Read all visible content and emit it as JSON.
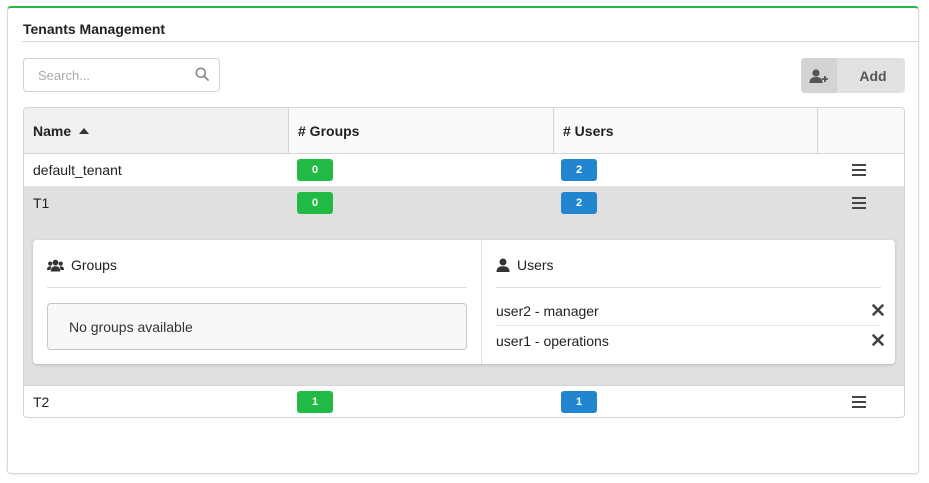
{
  "widget": {
    "title": "Tenants Management"
  },
  "search": {
    "placeholder": "Search..."
  },
  "add_button": {
    "label": "Add",
    "icon": "user-plus-icon"
  },
  "table": {
    "columns": [
      {
        "label": "Name",
        "sorted": "ascending"
      },
      {
        "label": "# Groups"
      },
      {
        "label": "# Users"
      },
      {
        "label": ""
      }
    ],
    "rows": [
      {
        "name": "default_tenant",
        "groups": "0",
        "users": "2",
        "selected": false
      },
      {
        "name": "T1",
        "groups": "0",
        "users": "2",
        "selected": true
      },
      {
        "name": "T2",
        "groups": "1",
        "users": "1",
        "selected": false
      }
    ]
  },
  "details": {
    "groups": {
      "title": "Groups",
      "icon": "users-icon",
      "empty_message": "No groups available"
    },
    "users": {
      "title": "Users",
      "icon": "user-icon",
      "items": [
        {
          "label": "user2 - manager",
          "action_icon": "remove-icon"
        },
        {
          "label": "user1 - operations",
          "action_icon": "remove-icon"
        }
      ]
    }
  },
  "colors": {
    "accent": "#21ba45",
    "groups_badge": "#21ba45",
    "users_badge": "#2185d0",
    "selected_row": "#e0e0e0"
  }
}
